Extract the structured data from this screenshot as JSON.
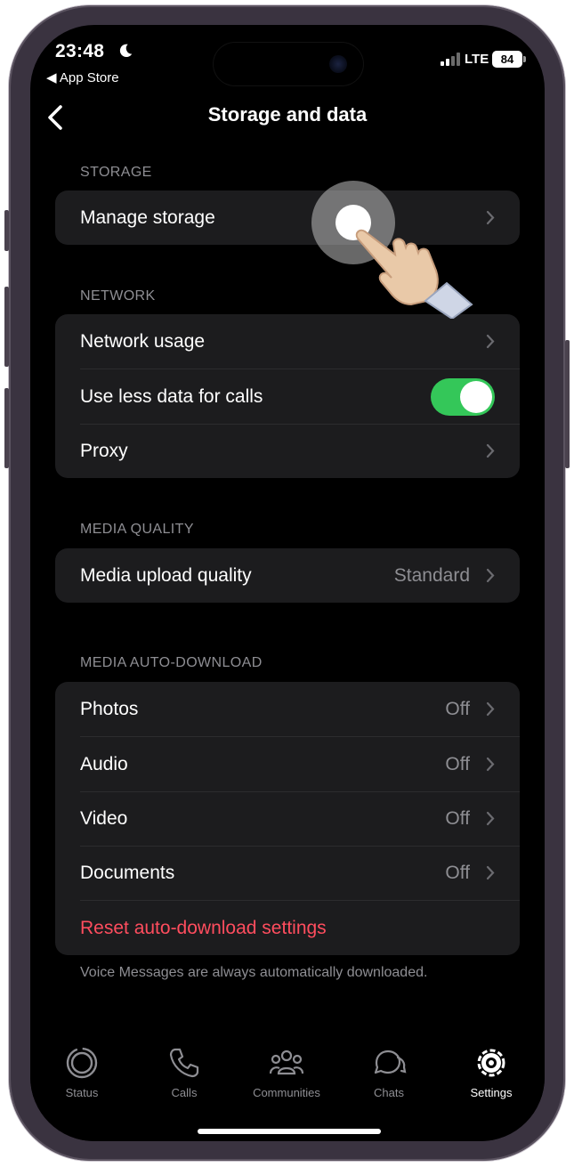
{
  "status_bar": {
    "time": "23:48",
    "back_to_app": "◀ App Store",
    "network": "LTE",
    "battery": "84"
  },
  "header": {
    "title": "Storage and data"
  },
  "sections": {
    "storage": {
      "label": "STORAGE",
      "rows": [
        {
          "label": "Manage storage"
        }
      ]
    },
    "network": {
      "label": "NETWORK",
      "rows": [
        {
          "label": "Network usage"
        },
        {
          "label": "Use less data for calls",
          "toggle_on": true
        },
        {
          "label": "Proxy"
        }
      ]
    },
    "media_quality": {
      "label": "MEDIA QUALITY",
      "rows": [
        {
          "label": "Media upload quality",
          "value": "Standard"
        }
      ]
    },
    "auto_download": {
      "label": "MEDIA AUTO-DOWNLOAD",
      "rows": [
        {
          "label": "Photos",
          "value": "Off"
        },
        {
          "label": "Audio",
          "value": "Off"
        },
        {
          "label": "Video",
          "value": "Off"
        },
        {
          "label": "Documents",
          "value": "Off"
        }
      ],
      "reset": "Reset auto-download settings",
      "footnote": "Voice Messages are always automatically downloaded."
    }
  },
  "tabbar": {
    "tabs": [
      {
        "label": "Status",
        "icon": "status-icon"
      },
      {
        "label": "Calls",
        "icon": "phone-icon"
      },
      {
        "label": "Communities",
        "icon": "communities-icon"
      },
      {
        "label": "Chats",
        "icon": "chats-icon"
      },
      {
        "label": "Settings",
        "icon": "gear-icon",
        "active": true
      }
    ]
  },
  "colors": {
    "background": "#000000",
    "cell": "#1c1c1e",
    "toggle_on": "#34c759",
    "destructive": "#ff4d5e",
    "secondary_text": "#8e8e93"
  }
}
